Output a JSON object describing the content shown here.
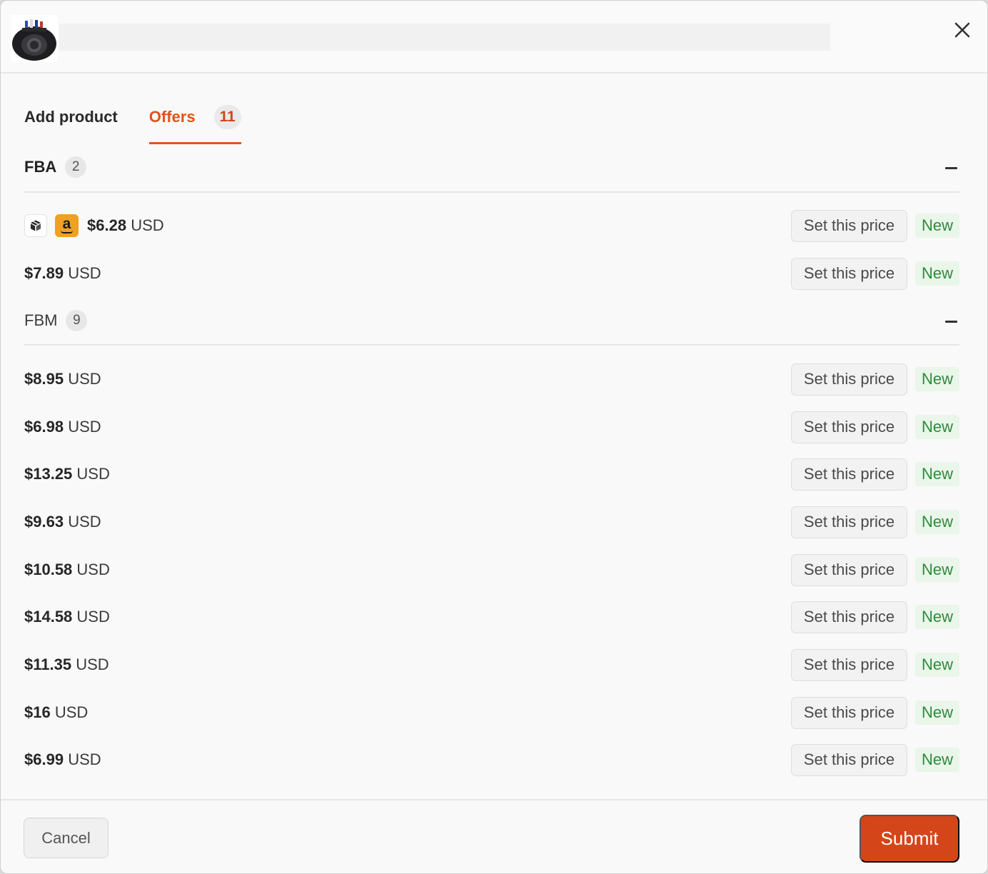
{
  "header": {
    "close_icon": "close-icon"
  },
  "tabs": [
    {
      "label": "Add product"
    },
    {
      "label": "Offers",
      "count": "11"
    }
  ],
  "fba": {
    "title": "FBA",
    "count": "2",
    "offers": [
      {
        "amount": "$6.28",
        "currency": "USD",
        "action": "Set this price",
        "condition": "New",
        "badges": [
          "package-icon",
          "amazon-icon"
        ]
      },
      {
        "amount": "$7.89",
        "currency": "USD",
        "action": "Set this price",
        "condition": "New"
      }
    ]
  },
  "fbm": {
    "title": "FBM",
    "count": "9",
    "offers": [
      {
        "amount": "$8.95",
        "currency": "USD",
        "action": "Set this price",
        "condition": "New"
      },
      {
        "amount": "$6.98",
        "currency": "USD",
        "action": "Set this price",
        "condition": "New"
      },
      {
        "amount": "$13.25",
        "currency": "USD",
        "action": "Set this price",
        "condition": "New"
      },
      {
        "amount": "$9.63",
        "currency": "USD",
        "action": "Set this price",
        "condition": "New"
      },
      {
        "amount": "$10.58",
        "currency": "USD",
        "action": "Set this price",
        "condition": "New"
      },
      {
        "amount": "$14.58",
        "currency": "USD",
        "action": "Set this price",
        "condition": "New"
      },
      {
        "amount": "$11.35",
        "currency": "USD",
        "action": "Set this price",
        "condition": "New"
      },
      {
        "amount": "$16",
        "currency": "USD",
        "action": "Set this price",
        "condition": "New"
      },
      {
        "amount": "$6.99",
        "currency": "USD",
        "action": "Set this price",
        "condition": "New"
      }
    ]
  },
  "footer": {
    "cancel_label": "Cancel",
    "submit_label": "Submit"
  },
  "colors": {
    "accent": "#e0531d",
    "submit": "#d44519",
    "condition_text": "#2f8a3d",
    "condition_bg": "#e9f6e9"
  }
}
